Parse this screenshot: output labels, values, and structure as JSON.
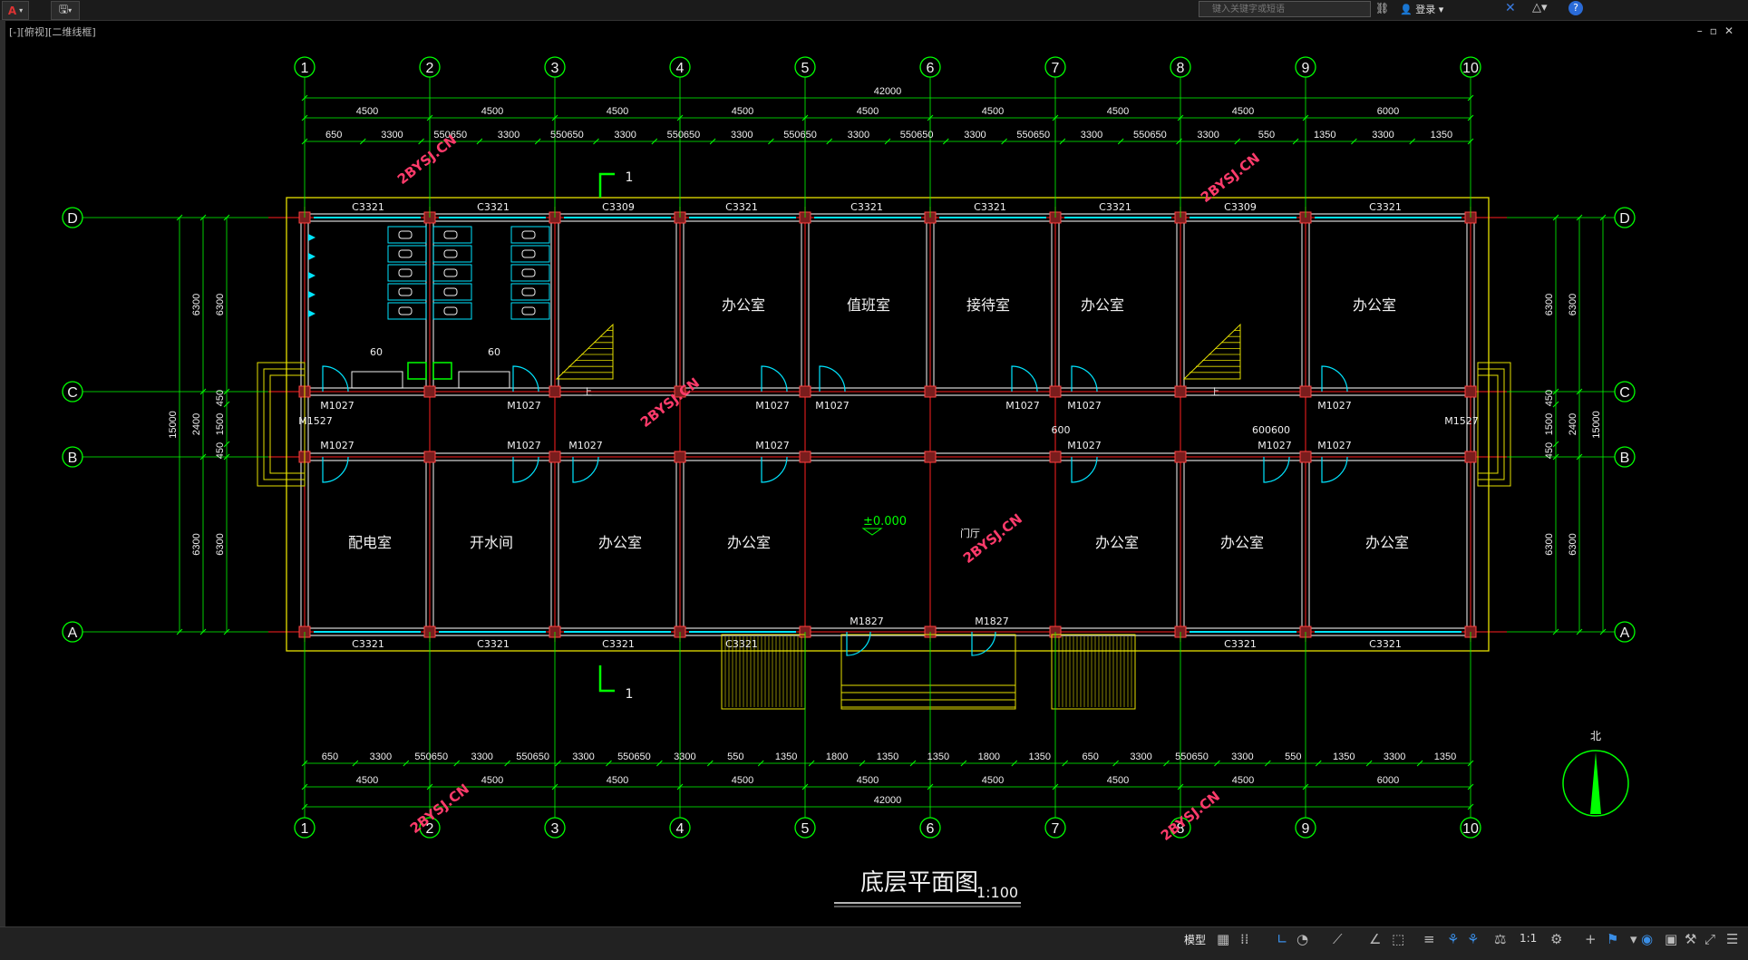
{
  "toolbar": {
    "app_logo": "A",
    "search_placeholder": "键入关键字或短语",
    "login_label": "登录"
  },
  "viewport": {
    "label": "[-][俯视][二维线框]"
  },
  "status": {
    "model_tab": "模型",
    "scale": "1:1"
  },
  "plan": {
    "title": "底层平面图",
    "scale": "1:100",
    "north_label": "北",
    "col_axes": [
      "1",
      "2",
      "3",
      "4",
      "5",
      "6",
      "7",
      "8",
      "9",
      "10"
    ],
    "row_axes": [
      "D",
      "C",
      "B",
      "A"
    ],
    "total_dim": "42000",
    "bay_dims": [
      "4500",
      "4500",
      "4500",
      "4500",
      "4500",
      "4500",
      "4500",
      "4500",
      "6000"
    ],
    "top_fine_dims": [
      "650",
      "3300",
      "550650",
      "3300",
      "550650",
      "3300",
      "550650",
      "3300",
      "550650",
      "3300",
      "550650",
      "3300",
      "550650",
      "3300",
      "550650",
      "3300",
      "550",
      "1350",
      "3300",
      "1350"
    ],
    "bottom_fine_dims": [
      "650",
      "3300",
      "550650",
      "3300",
      "550650",
      "3300",
      "550650",
      "3300",
      "550",
      "1350",
      "1800",
      "1350",
      "1350",
      "1800",
      "1350",
      "650",
      "3300",
      "550650",
      "3300",
      "550",
      "1350",
      "3300",
      "1350"
    ],
    "left_dims": {
      "outer": "15000",
      "a": "6300",
      "b": "2400",
      "c": "6300",
      "d": "6300",
      "e": "450",
      "f": "1500",
      "g": "450",
      "h": "6300"
    },
    "top_windows": [
      "C3321",
      "C3321",
      "C3309",
      "C3321",
      "C3321",
      "C3321",
      "C3321",
      "C3309",
      "C3321"
    ],
    "bottom_windows": [
      "C3321",
      "C3321",
      "C3321",
      "C3321",
      "C3321",
      "C3321"
    ],
    "rooms_north": [
      "办公室",
      "值班室",
      "接待室",
      "办公室",
      "办公室"
    ],
    "rooms_south": [
      "配电室",
      "开水间",
      "办公室",
      "办公室",
      "办公室",
      "办公室",
      "办公室"
    ],
    "door_m1027": "M1027",
    "door_m1527": "M1527",
    "door_m1827": "M1827",
    "section_mark": "1",
    "stair_up": "上",
    "elevation": "±0.000",
    "lobby": "门厅",
    "small_dims": [
      "600",
      "600600",
      "60",
      "60"
    ],
    "watermark": "2BYSJ.CN"
  }
}
